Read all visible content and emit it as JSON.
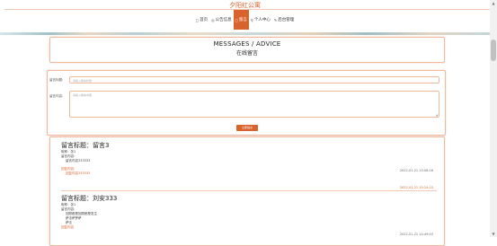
{
  "site": {
    "title": "夕阳红公寓"
  },
  "nav": {
    "items": [
      {
        "icon": "home-icon",
        "glyph": "◻",
        "label": "首页",
        "active": false
      },
      {
        "icon": "announcement-icon",
        "glyph": "◎",
        "label": "公告信息",
        "active": false
      },
      {
        "icon": "message-icon",
        "glyph": "◻",
        "label": "留言",
        "active": true
      },
      {
        "icon": "user-icon",
        "glyph": "⚲",
        "label": "个人中心",
        "active": false
      },
      {
        "icon": "admin-icon",
        "glyph": "✎",
        "label": "后台管理",
        "active": false
      }
    ]
  },
  "header": {
    "en": "MESSAGES / ADVICE",
    "cn": "在线留言"
  },
  "form": {
    "title_label": "留言标题:",
    "title_placeholder": "请输入留言标题",
    "content_label": "留言内容:",
    "content_placeholder": "请输入留言内容",
    "submit_label": "立即提交"
  },
  "messages": [
    {
      "title": "留言标题：留言3",
      "user": "昵称：张1",
      "content_label": "留言内容：",
      "content_lines": [
        "留言内容333333"
      ],
      "reply_label": "回复内容：",
      "reply_lines": [
        "回复内容333333"
      ],
      "date": "2022-01-21 15:06:16",
      "reply_date": "2022-01-21 15:24:15"
    },
    {
      "title": "留言标题：刘安333",
      "user": "昵称：张1",
      "content_label": "留言内容：",
      "content_lines": [
        "回顾都是回顾都是发生",
        "萨法萨罗萨",
        "萨法"
      ],
      "reply_label": "回复内容",
      "reply_lines": [],
      "date": "2022-01-21 14:49:03"
    }
  ]
}
